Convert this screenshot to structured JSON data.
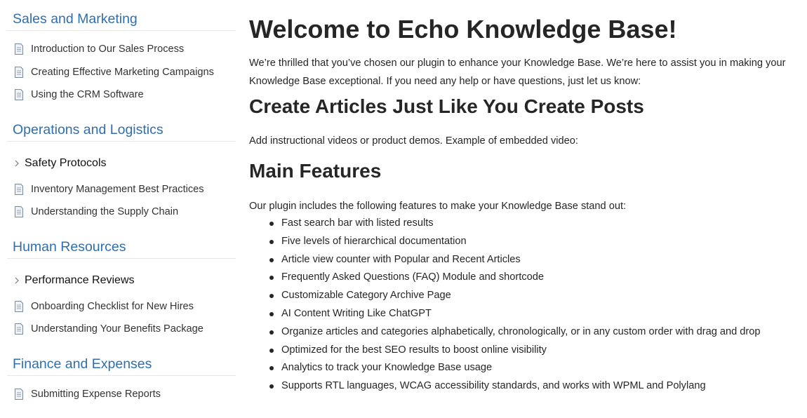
{
  "sidebar": {
    "categories": [
      {
        "title": "Sales and Marketing",
        "articles": [
          "Introduction to Our Sales Process",
          "Creating Effective Marketing Campaigns",
          "Using the CRM Software"
        ]
      },
      {
        "title": "Operations and Logistics",
        "subcategory": "Safety Protocols",
        "articles": [
          "Inventory Management Best Practices",
          "Understanding the Supply Chain"
        ]
      },
      {
        "title": "Human Resources",
        "subcategory": "Performance Reviews",
        "articles": [
          "Onboarding Checklist for New Hires",
          "Understanding Your Benefits Package"
        ]
      },
      {
        "title": "Finance and Expenses",
        "articles": [
          "Submitting Expense Reports"
        ]
      }
    ],
    "article_icon": "document-icon",
    "subcategory_icon": "chevron-right-icon"
  },
  "main": {
    "title": "Welcome to Echo Knowledge Base!",
    "intro": "We’re thrilled that you’ve chosen our plugin to enhance your Knowledge Base. We’re here to assist you in making your Knowledge Base exceptional. If you need any help or have questions, just let us know:",
    "section1_heading": "Create Articles Just Like You Create Posts",
    "section1_text": "Add instructional videos or product demos. Example of embedded video:",
    "section2_heading": "Main Features",
    "section2_text": "Our plugin includes the following features to make your Knowledge Base stand out:",
    "features": [
      "Fast search bar with listed results",
      "Five levels of hierarchical documentation",
      "Article view counter with Popular and Recent Articles",
      "Frequently Asked Questions (FAQ) Module and shortcode",
      "Customizable Category Archive Page",
      "AI Content Writing Like ChatGPT",
      "Organize articles and categories alphabetically, chronologically, or in any custom order with drag and drop",
      "Optimized for the best SEO results to boost online visibility",
      "Analytics to track your Knowledge Base usage",
      "Supports RTL languages, WCAG accessibility standards, and works with WPML and Polylang"
    ]
  },
  "colors": {
    "category_link": "#2f6fad",
    "text": "#262626",
    "divider": "#e8e8e8"
  }
}
